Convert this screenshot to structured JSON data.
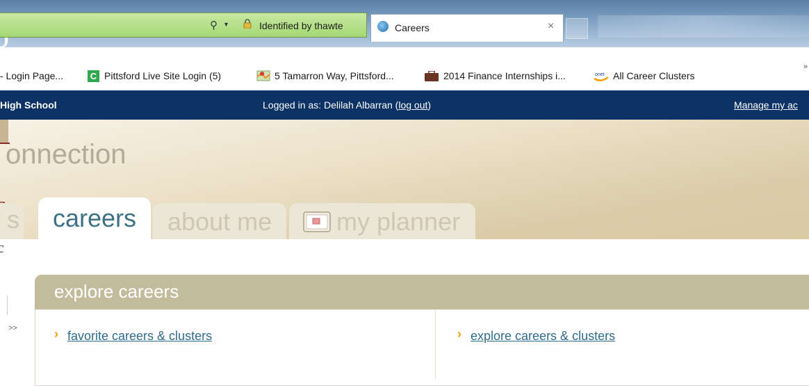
{
  "browser": {
    "identity_text": "Identified by thawte",
    "tab_title": "Careers",
    "tab_close": "×",
    "search_glyph": "⚲",
    "dropdown_glyph": "▼",
    "partial_left_letter": "o"
  },
  "favorites": [
    {
      "label": "- Login Page...",
      "icon": "none"
    },
    {
      "label": "Pittsford Live Site Login (5)",
      "icon": "green-c-icon",
      "icon_text": "C"
    },
    {
      "label": "5 Tamarron Way, Pittsford...",
      "icon": "map-icon"
    },
    {
      "label": "2014 Finance Internships i...",
      "icon": "briefcase-icon"
    },
    {
      "label": "All Career Clusters",
      "icon": "onet-icon",
      "icon_text": "onet"
    }
  ],
  "favorites_more": "»",
  "site_bar": {
    "school": "High School",
    "login_prefix": "Logged in as: Delilah Albarran (",
    "logout": "log out",
    "login_suffix": ")",
    "manage": "Manage my ac"
  },
  "header": {
    "brand": "onnection",
    "partial_left_letter": "c"
  },
  "nav_tabs": [
    {
      "label": "s",
      "active": false
    },
    {
      "label": "careers",
      "active": true
    },
    {
      "label": "about me",
      "active": false
    },
    {
      "label": "my planner",
      "active": false,
      "icon": "calendar-icon"
    }
  ],
  "content": {
    "partial_left_letter": "c",
    "expand_glyph": ">>",
    "panel_title": "explore careers",
    "links": [
      {
        "label": "favorite careers & clusters"
      },
      {
        "label": "explore careers & clusters"
      }
    ],
    "chevron_glyph": "›"
  },
  "colors": {
    "navy": "#0c3266",
    "panel_header": "#c3bc9c",
    "active_tab_text": "#3f7184",
    "link": "#2f6b8a",
    "chevron": "#f2a100",
    "address_bar": "#a4d873"
  }
}
